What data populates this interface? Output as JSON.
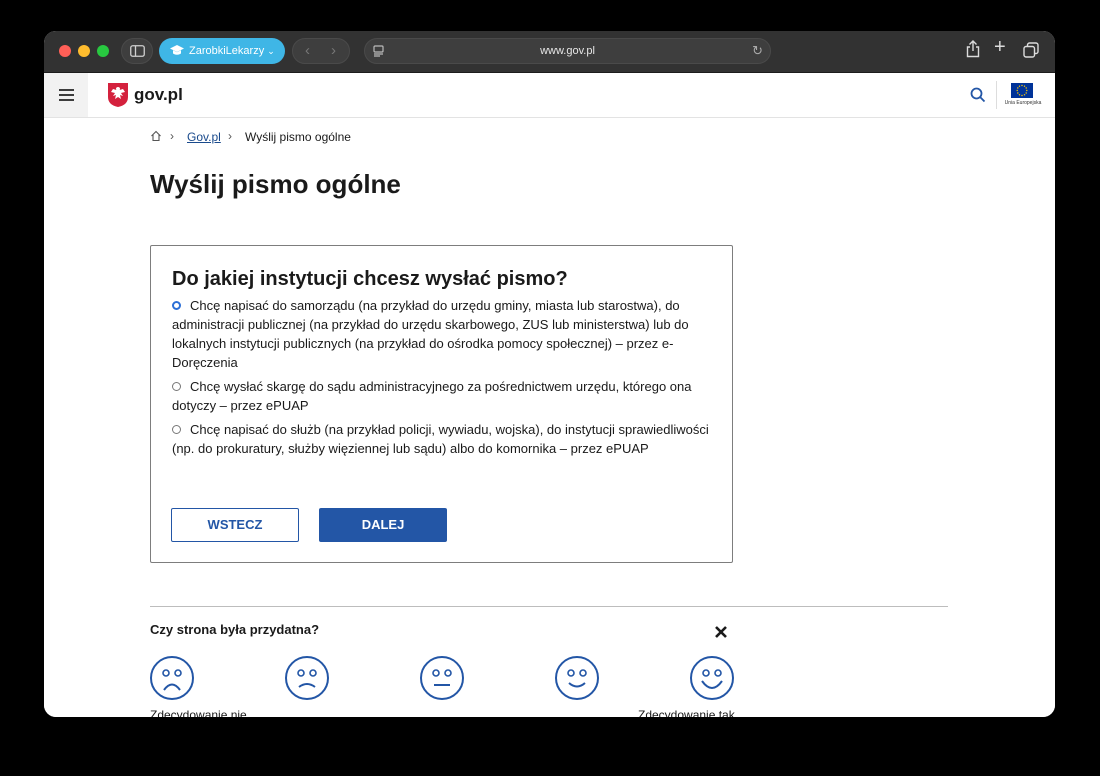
{
  "browser": {
    "tab_group_label": "ZarobkiLekarzy",
    "address": "www.gov.pl"
  },
  "site": {
    "logo_text": "gov.pl",
    "eu_label": "Unia Europejska"
  },
  "breadcrumb": {
    "home": "Gov.pl",
    "current": "Wyślij pismo ogólne"
  },
  "page_title": "Wyślij pismo ogólne",
  "form": {
    "question": "Do jakiej instytucji chcesz wysłać pismo?",
    "options": [
      {
        "label": "Chcę napisać do samorządu (na przykład do urzędu gminy, miasta lub starostwa), do administracji publicznej (na przykład do urzędu skarbowego, ZUS lub ministerstwa) lub do lokalnych instytucji publicznych (na przykład do ośrodka pomocy społecznej) – przez e-Doręczenia",
        "selected": true
      },
      {
        "label": "Chcę wysłać skargę do sądu administracyjnego za pośrednictwem urzędu, którego ona dotyczy – przez ePUAP",
        "selected": false
      },
      {
        "label": "Chcę napisać do służb (na przykład policji, wywiadu, wojska), do instytucji sprawiedliwości (np. do prokuratury, służby więziennej lub sądu) albo do komornika – przez ePUAP",
        "selected": false
      }
    ],
    "back_label": "WSTECZ",
    "next_label": "DALEJ"
  },
  "feedback": {
    "question": "Czy strona była przydatna?",
    "label_min": "Zdecydowanie nie",
    "label_max": "Zdecydowanie tak"
  },
  "colors": {
    "primary": "#2356a6",
    "radio_selected": "#2c6fd6",
    "tab_group": "#3fb6e6"
  }
}
